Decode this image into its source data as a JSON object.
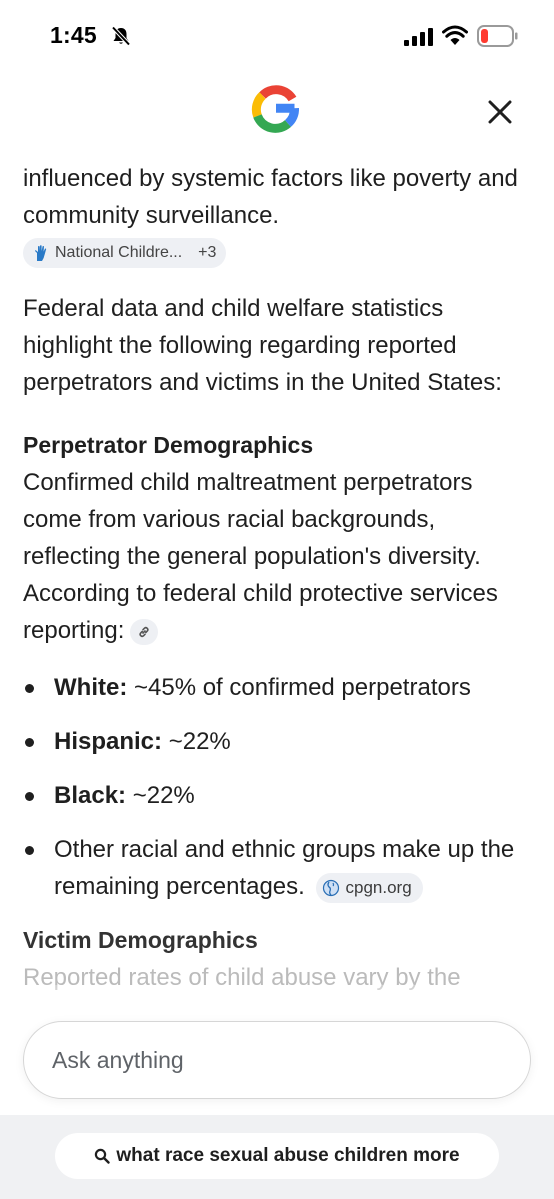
{
  "status_bar": {
    "time": "1:45"
  },
  "content": {
    "intro_text": "influenced by systemic factors like poverty and community surveillance.",
    "source_chip": {
      "label": "National Childre...",
      "extra": "+3"
    },
    "summary_text": "Federal data and child welfare statistics highlight the following regarding reported perpetrators and victims in the United States:",
    "perpetrator_section": {
      "heading": "Perpetrator Demographics",
      "body": "Confirmed child maltreatment perpetrators come from various racial backgrounds, reflecting the general population's diversity. According to federal child protective services reporting:"
    },
    "bullets": [
      {
        "bold": "White:",
        "text": " ~45% of confirmed perpetrators"
      },
      {
        "bold": "Hispanic:",
        "text": " ~22%"
      },
      {
        "bold": "Black:",
        "text": " ~22%"
      },
      {
        "bold": "",
        "text": "Other racial and ethnic groups make up the remaining percentages."
      }
    ],
    "bullet_source": {
      "label": "cpgn.org"
    },
    "victim_section": {
      "heading": "Victim Demographics",
      "cut_text": "Reported rates of child abuse vary by the"
    }
  },
  "ask_bar": {
    "placeholder": "Ask anything"
  },
  "footer": {
    "query": "what race sexual abuse children more"
  },
  "colors": {
    "google_blue": "#4285F4",
    "google_red": "#EA4335",
    "google_yellow": "#FBBC05",
    "google_green": "#34A853",
    "battery_red": "#ff3b30"
  }
}
